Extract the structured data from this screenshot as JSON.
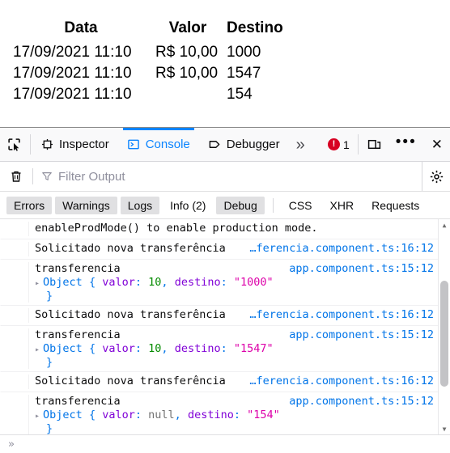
{
  "page": {
    "table": {
      "headers": [
        "Data",
        "Valor",
        "Destino"
      ],
      "rows": [
        {
          "data": "17/09/2021 11:10",
          "valor": "R$ 10,00",
          "destino": "1000"
        },
        {
          "data": "17/09/2021 11:10",
          "valor": "R$ 10,00",
          "destino": "1547"
        },
        {
          "data": "17/09/2021 11:10",
          "valor": "",
          "destino": "154"
        }
      ]
    }
  },
  "devtools": {
    "toolbar": {
      "picker_icon": "element-picker-icon",
      "tabs": [
        {
          "label": "Inspector",
          "icon": "inspector-target-icon",
          "active": false
        },
        {
          "label": "Console",
          "icon": "console-prompt-icon",
          "active": true
        },
        {
          "label": "Debugger",
          "icon": "debugger-tag-icon",
          "active": false
        }
      ],
      "overflow_label": "»",
      "error_count": "1",
      "error_icon": "error-exclamation-icon",
      "responsive_icon": "responsive-design-mode-icon",
      "meatball_label": "•••",
      "close_label": "✕"
    },
    "filter_toolbar": {
      "clear_icon": "trash-can-icon",
      "filter_icon": "funnel-icon",
      "filter_placeholder": "Filter Output",
      "filter_value": "",
      "settings_icon": "gear-icon"
    },
    "filters": [
      {
        "label": "Errors",
        "active": true
      },
      {
        "label": "Warnings",
        "active": true
      },
      {
        "label": "Logs",
        "active": true
      },
      {
        "label": "Info (2)",
        "active": false
      },
      {
        "label": "Debug",
        "active": true
      },
      {
        "label": "CSS",
        "active": false
      },
      {
        "label": "XHR",
        "active": false
      },
      {
        "label": "Requests",
        "active": false
      }
    ],
    "messages": [
      {
        "type": "text",
        "text": "enableProdMode() to enable production mode.",
        "source": ""
      },
      {
        "type": "text",
        "text": "Solicitado nova transferência",
        "source": "…ferencia.component.ts:16:12"
      },
      {
        "type": "object",
        "text": "transferencia",
        "source": "app.component.ts:15:12",
        "object": {
          "twisty": "▸",
          "name": "Object",
          "open_brace": "{",
          "close_brace": "}",
          "props": [
            {
              "key": "valor",
              "value": "10",
              "kind": "num",
              "trailing": ","
            },
            {
              "key": "destino",
              "value": "\"1000\"",
              "kind": "str",
              "trailing": ""
            }
          ]
        }
      },
      {
        "type": "text",
        "text": "Solicitado nova transferência",
        "source": "…ferencia.component.ts:16:12"
      },
      {
        "type": "object",
        "text": "transferencia",
        "source": "app.component.ts:15:12",
        "object": {
          "twisty": "▸",
          "name": "Object",
          "open_brace": "{",
          "close_brace": "}",
          "props": [
            {
              "key": "valor",
              "value": "10",
              "kind": "num",
              "trailing": ","
            },
            {
              "key": "destino",
              "value": "\"1547\"",
              "kind": "str",
              "trailing": ""
            }
          ]
        }
      },
      {
        "type": "text",
        "text": "Solicitado nova transferência",
        "source": "…ferencia.component.ts:16:12"
      },
      {
        "type": "object",
        "text": "transferencia",
        "source": "app.component.ts:15:12",
        "object": {
          "twisty": "▸",
          "name": "Object",
          "open_brace": "{",
          "close_brace": "}",
          "props": [
            {
              "key": "valor",
              "value": "null",
              "kind": "nullv",
              "trailing": ","
            },
            {
              "key": "destino",
              "value": "\"154\"",
              "kind": "str",
              "trailing": ""
            }
          ]
        }
      }
    ],
    "input_prompt": "»"
  },
  "colors": {
    "accent": "#0a84ff",
    "link": "#0074e8",
    "error": "#d70022",
    "property": "#8000d7",
    "number": "#058b00",
    "string": "#dd00a9",
    "null": "#737373"
  }
}
